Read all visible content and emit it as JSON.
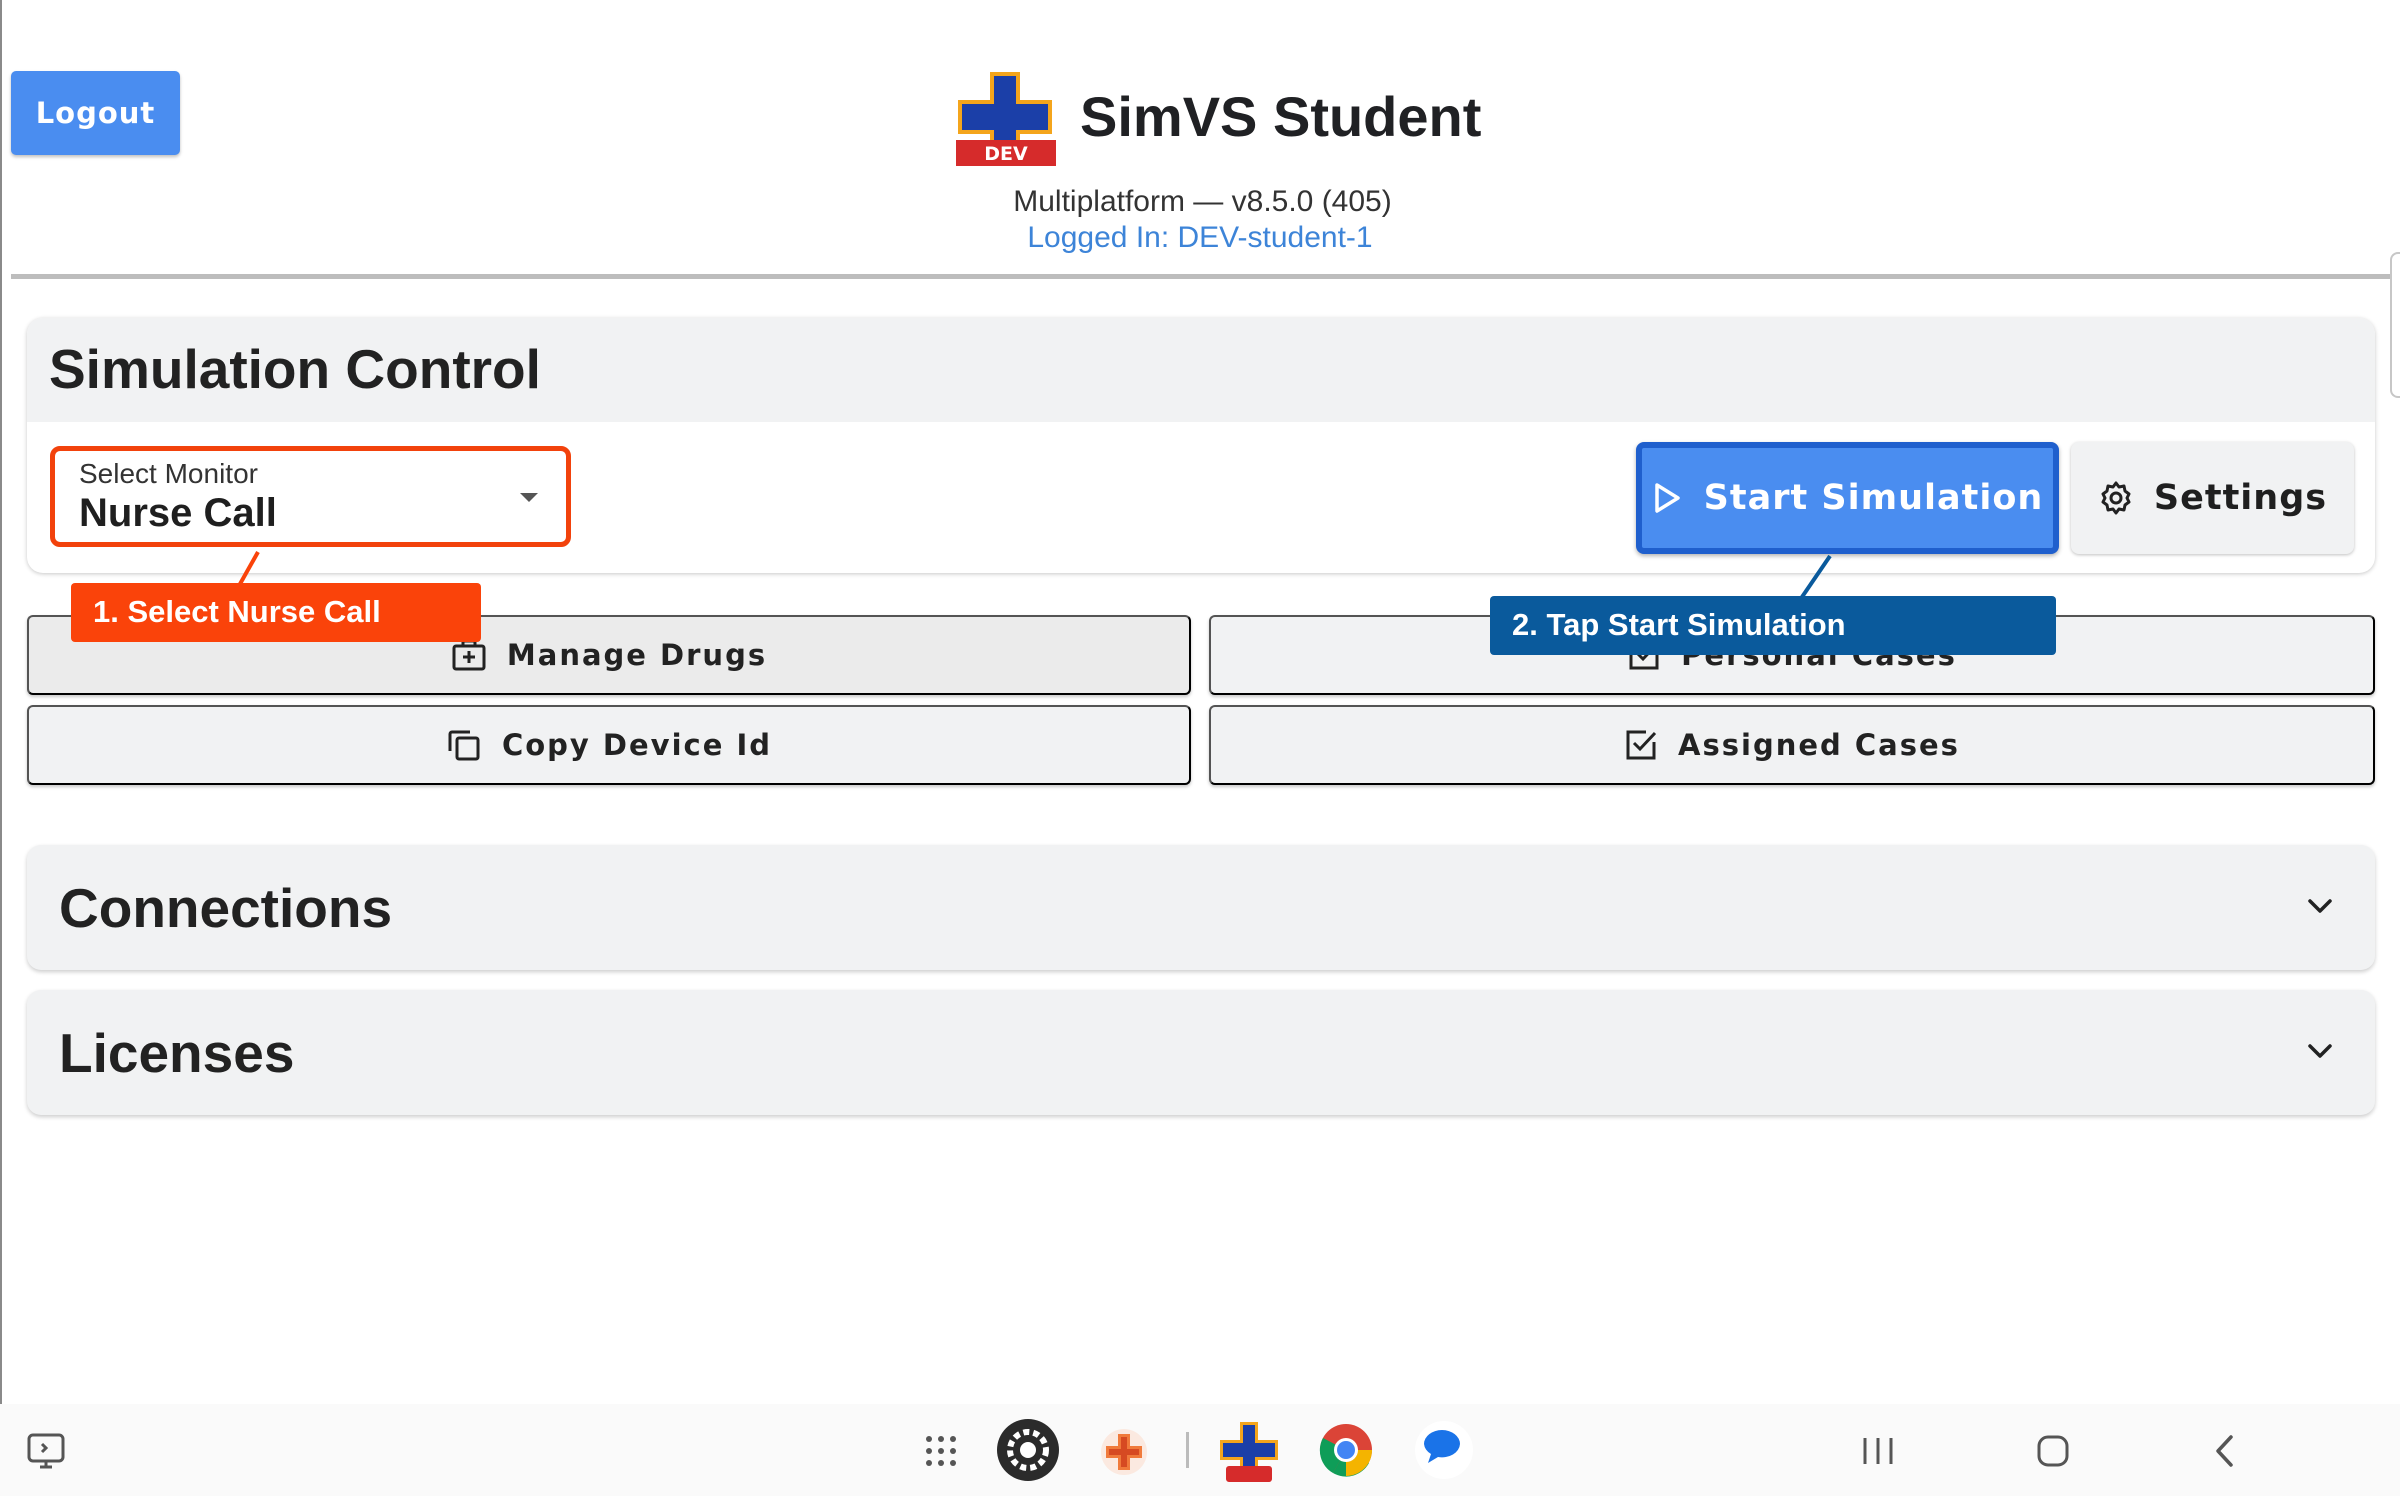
{
  "header": {
    "logout_label": "Logout",
    "app_title": "SimVS Student",
    "logo_badge": "DEV",
    "version_text": "Multiplatform — v8.5.0 (405)",
    "logged_in_text": "Logged In: DEV-student-1"
  },
  "simulation_control": {
    "title": "Simulation Control",
    "monitor_select": {
      "label": "Select Monitor",
      "value": "Nurse Call"
    },
    "start_label": "Start Simulation",
    "settings_label": "Settings"
  },
  "actions": {
    "manage_drugs": "Manage Drugs",
    "personal_cases": "Personal Cases",
    "copy_device_id": "Copy Device Id",
    "assigned_cases": "Assigned Cases"
  },
  "callouts": {
    "step1": "1. Select Nurse Call",
    "step2": "2. Tap Start Simulation"
  },
  "sections": {
    "connections": "Connections",
    "licenses": "Licenses"
  },
  "colors": {
    "primary_button": "#4a8df0",
    "callout_orange": "#fa430a",
    "callout_blue": "#0a5a9c",
    "logged_in_text": "#3d84d8"
  },
  "nav_bar": {
    "icons": [
      "screen-share-icon",
      "app-grid-icon",
      "settings-app-icon",
      "simvs-app-icon",
      "simvs-dev-app-icon",
      "chrome-app-icon",
      "messages-app-icon",
      "recents-icon",
      "home-icon",
      "back-icon"
    ]
  }
}
